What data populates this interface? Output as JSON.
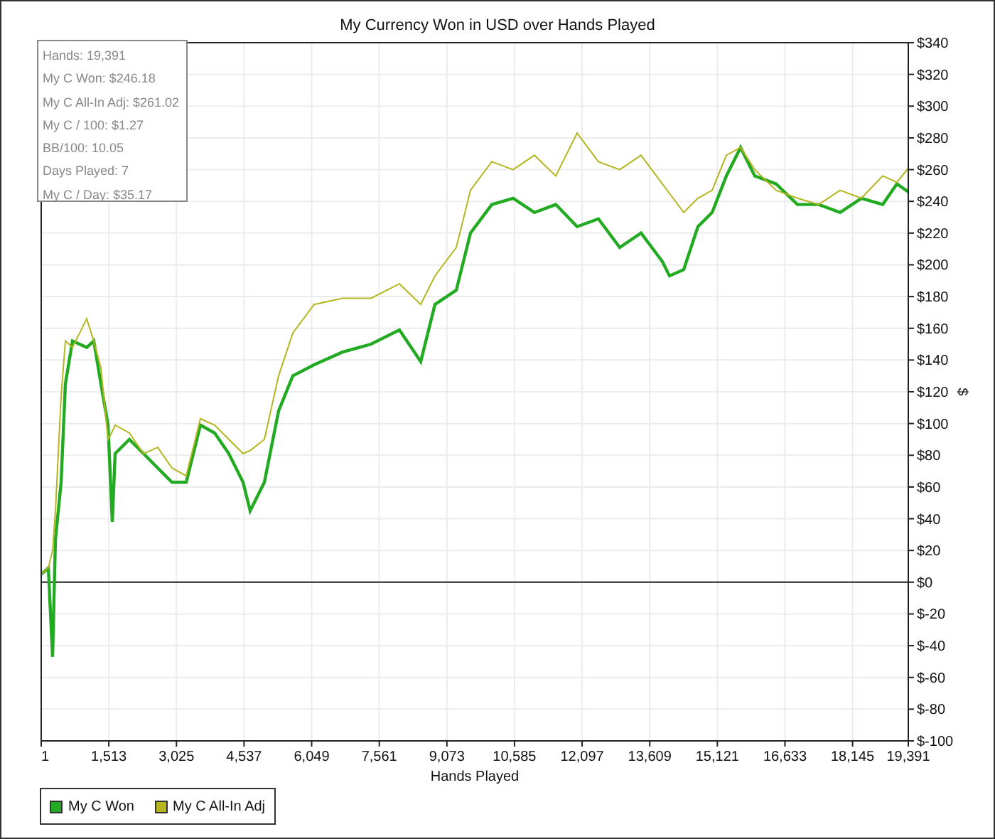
{
  "chart": {
    "title": "My Currency Won in USD over Hands Played",
    "stats": [
      "Hands: 19,391",
      "My C Won: $246.18",
      "My C All-In Adj: $261.02",
      "My C / 100: $1.27",
      "BB/100: 10.05",
      "Days Played: 7",
      "My C / Day: $35.17"
    ],
    "chart_data": {
      "type": "line",
      "grid": true,
      "xlabel": "Hands Played",
      "ylabel": "$",
      "xlim": [
        1,
        19391
      ],
      "ylim": [
        -100,
        340
      ],
      "x": [
        1,
        160,
        255,
        319,
        446,
        541,
        700,
        1018,
        1177,
        1336,
        1495,
        1590,
        1654,
        1972,
        2290,
        2608,
        2925,
        3243,
        3561,
        3879,
        4197,
        4515,
        4674,
        4992,
        5309,
        5627,
        6104,
        6740,
        7376,
        8011,
        8488,
        8806,
        9283,
        9601,
        10077,
        10554,
        11031,
        11508,
        11985,
        12462,
        12938,
        13415,
        13892,
        14051,
        14369,
        14687,
        15004,
        15322,
        15640,
        15958,
        16435,
        16912,
        17389,
        17865,
        18342,
        18819,
        19137,
        19391
      ],
      "series": [
        {
          "name": "My C Won",
          "color": "#22aa22",
          "values": [
            5,
            9,
            -47,
            27,
            63,
            125,
            152,
            148,
            152,
            125,
            99,
            38,
            81,
            90,
            81,
            72,
            63,
            63,
            99,
            94,
            81,
            63,
            45,
            63,
            108,
            130,
            137,
            145,
            150,
            159,
            139,
            175,
            184,
            220,
            238,
            242,
            233,
            238,
            224,
            229,
            211,
            220,
            202,
            193,
            197,
            224,
            233,
            256,
            274,
            256,
            251,
            238,
            238,
            233,
            242,
            238,
            251,
            246
          ]
        },
        {
          "name": "My C All-In Adj",
          "color": "#b5b520",
          "values": [
            5,
            9,
            20,
            45,
            117,
            152,
            148,
            166,
            152,
            135,
            90,
            95,
            99,
            94,
            81,
            85,
            72,
            67,
            103,
            99,
            90,
            81,
            83,
            90,
            130,
            157,
            175,
            179,
            179,
            188,
            175,
            193,
            211,
            247,
            265,
            260,
            269,
            256,
            283,
            265,
            260,
            269,
            251,
            245,
            233,
            242,
            247,
            269,
            274,
            260,
            247,
            242,
            238,
            247,
            242,
            256,
            252,
            261
          ]
        }
      ],
      "xticks": [
        {
          "value": 1,
          "label": "1"
        },
        {
          "value": 1513,
          "label": "1,513"
        },
        {
          "value": 3025,
          "label": "3,025"
        },
        {
          "value": 4537,
          "label": "4,537"
        },
        {
          "value": 6049,
          "label": "6,049"
        },
        {
          "value": 7561,
          "label": "7,561"
        },
        {
          "value": 9073,
          "label": "9,073"
        },
        {
          "value": 10585,
          "label": "10,585"
        },
        {
          "value": 12097,
          "label": "12,097"
        },
        {
          "value": 13609,
          "label": "13,609"
        },
        {
          "value": 15121,
          "label": "15,121"
        },
        {
          "value": 16633,
          "label": "16,633"
        },
        {
          "value": 18145,
          "label": "18,145"
        },
        {
          "value": 19391,
          "label": "19,391"
        }
      ],
      "yticks": [
        {
          "value": 340,
          "label": "$340"
        },
        {
          "value": 320,
          "label": "$320"
        },
        {
          "value": 300,
          "label": "$300"
        },
        {
          "value": 280,
          "label": "$280"
        },
        {
          "value": 260,
          "label": "$260"
        },
        {
          "value": 240,
          "label": "$240"
        },
        {
          "value": 220,
          "label": "$220"
        },
        {
          "value": 200,
          "label": "$200"
        },
        {
          "value": 180,
          "label": "$180"
        },
        {
          "value": 160,
          "label": "$160"
        },
        {
          "value": 140,
          "label": "$140"
        },
        {
          "value": 120,
          "label": "$120"
        },
        {
          "value": 100,
          "label": "$100"
        },
        {
          "value": 80,
          "label": "$80"
        },
        {
          "value": 60,
          "label": "$60"
        },
        {
          "value": 40,
          "label": "$40"
        },
        {
          "value": 20,
          "label": "$20"
        },
        {
          "value": 0,
          "label": "$0"
        },
        {
          "value": -20,
          "label": "$-20"
        },
        {
          "value": -40,
          "label": "$-40"
        },
        {
          "value": -60,
          "label": "$-60"
        },
        {
          "value": -80,
          "label": "$-80"
        },
        {
          "value": -100,
          "label": "$-100"
        }
      ]
    }
  },
  "show_legend": true
}
